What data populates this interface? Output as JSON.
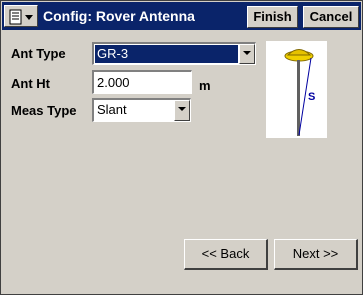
{
  "window": {
    "title": "Config: Rover Antenna"
  },
  "toolbar": {
    "menu_icon": "menu-list-icon",
    "finish_label": "Finish",
    "cancel_label": "Cancel"
  },
  "form": {
    "ant_type": {
      "label": "Ant Type",
      "value": "GR-3"
    },
    "ant_ht": {
      "label": "Ant Ht",
      "value": "2.000",
      "unit": "m"
    },
    "meas_type": {
      "label": "Meas Type",
      "value": "Slant"
    }
  },
  "diagram": {
    "icon": "antenna-slant-icon",
    "label": "S"
  },
  "nav": {
    "back_label": "<< Back",
    "next_label": "Next >>"
  },
  "colors": {
    "titlebar": "#0a246a",
    "background": "#d4d0c8",
    "selection": "#0a246a"
  }
}
